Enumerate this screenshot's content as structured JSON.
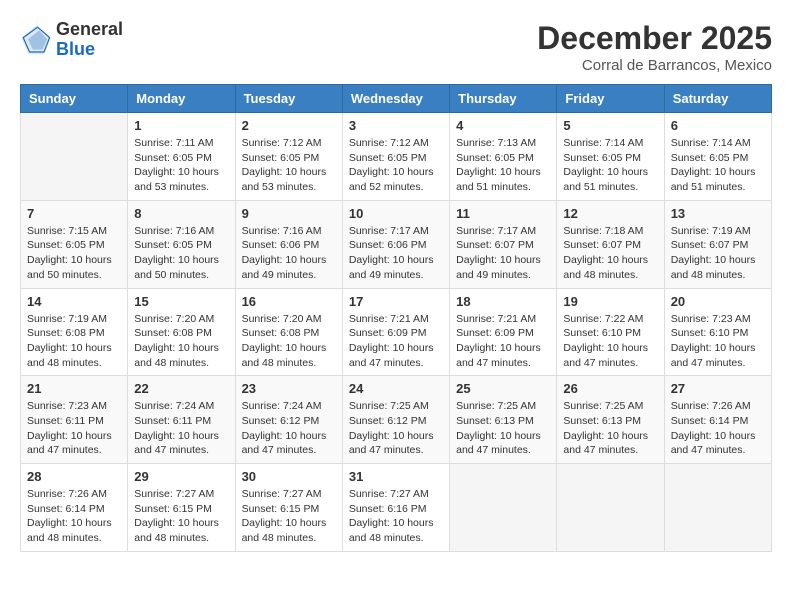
{
  "header": {
    "logo": {
      "general": "General",
      "blue": "Blue"
    },
    "title": "December 2025",
    "location": "Corral de Barrancos, Mexico"
  },
  "days_of_week": [
    "Sunday",
    "Monday",
    "Tuesday",
    "Wednesday",
    "Thursday",
    "Friday",
    "Saturday"
  ],
  "weeks": [
    [
      {
        "day": "",
        "info": ""
      },
      {
        "day": "1",
        "info": "Sunrise: 7:11 AM\nSunset: 6:05 PM\nDaylight: 10 hours\nand 53 minutes."
      },
      {
        "day": "2",
        "info": "Sunrise: 7:12 AM\nSunset: 6:05 PM\nDaylight: 10 hours\nand 53 minutes."
      },
      {
        "day": "3",
        "info": "Sunrise: 7:12 AM\nSunset: 6:05 PM\nDaylight: 10 hours\nand 52 minutes."
      },
      {
        "day": "4",
        "info": "Sunrise: 7:13 AM\nSunset: 6:05 PM\nDaylight: 10 hours\nand 51 minutes."
      },
      {
        "day": "5",
        "info": "Sunrise: 7:14 AM\nSunset: 6:05 PM\nDaylight: 10 hours\nand 51 minutes."
      },
      {
        "day": "6",
        "info": "Sunrise: 7:14 AM\nSunset: 6:05 PM\nDaylight: 10 hours\nand 51 minutes."
      }
    ],
    [
      {
        "day": "7",
        "info": "Sunrise: 7:15 AM\nSunset: 6:05 PM\nDaylight: 10 hours\nand 50 minutes."
      },
      {
        "day": "8",
        "info": "Sunrise: 7:16 AM\nSunset: 6:05 PM\nDaylight: 10 hours\nand 50 minutes."
      },
      {
        "day": "9",
        "info": "Sunrise: 7:16 AM\nSunset: 6:06 PM\nDaylight: 10 hours\nand 49 minutes."
      },
      {
        "day": "10",
        "info": "Sunrise: 7:17 AM\nSunset: 6:06 PM\nDaylight: 10 hours\nand 49 minutes."
      },
      {
        "day": "11",
        "info": "Sunrise: 7:17 AM\nSunset: 6:07 PM\nDaylight: 10 hours\nand 49 minutes."
      },
      {
        "day": "12",
        "info": "Sunrise: 7:18 AM\nSunset: 6:07 PM\nDaylight: 10 hours\nand 48 minutes."
      },
      {
        "day": "13",
        "info": "Sunrise: 7:19 AM\nSunset: 6:07 PM\nDaylight: 10 hours\nand 48 minutes."
      }
    ],
    [
      {
        "day": "14",
        "info": "Sunrise: 7:19 AM\nSunset: 6:08 PM\nDaylight: 10 hours\nand 48 minutes."
      },
      {
        "day": "15",
        "info": "Sunrise: 7:20 AM\nSunset: 6:08 PM\nDaylight: 10 hours\nand 48 minutes."
      },
      {
        "day": "16",
        "info": "Sunrise: 7:20 AM\nSunset: 6:08 PM\nDaylight: 10 hours\nand 48 minutes."
      },
      {
        "day": "17",
        "info": "Sunrise: 7:21 AM\nSunset: 6:09 PM\nDaylight: 10 hours\nand 47 minutes."
      },
      {
        "day": "18",
        "info": "Sunrise: 7:21 AM\nSunset: 6:09 PM\nDaylight: 10 hours\nand 47 minutes."
      },
      {
        "day": "19",
        "info": "Sunrise: 7:22 AM\nSunset: 6:10 PM\nDaylight: 10 hours\nand 47 minutes."
      },
      {
        "day": "20",
        "info": "Sunrise: 7:23 AM\nSunset: 6:10 PM\nDaylight: 10 hours\nand 47 minutes."
      }
    ],
    [
      {
        "day": "21",
        "info": "Sunrise: 7:23 AM\nSunset: 6:11 PM\nDaylight: 10 hours\nand 47 minutes."
      },
      {
        "day": "22",
        "info": "Sunrise: 7:24 AM\nSunset: 6:11 PM\nDaylight: 10 hours\nand 47 minutes."
      },
      {
        "day": "23",
        "info": "Sunrise: 7:24 AM\nSunset: 6:12 PM\nDaylight: 10 hours\nand 47 minutes."
      },
      {
        "day": "24",
        "info": "Sunrise: 7:25 AM\nSunset: 6:12 PM\nDaylight: 10 hours\nand 47 minutes."
      },
      {
        "day": "25",
        "info": "Sunrise: 7:25 AM\nSunset: 6:13 PM\nDaylight: 10 hours\nand 47 minutes."
      },
      {
        "day": "26",
        "info": "Sunrise: 7:25 AM\nSunset: 6:13 PM\nDaylight: 10 hours\nand 47 minutes."
      },
      {
        "day": "27",
        "info": "Sunrise: 7:26 AM\nSunset: 6:14 PM\nDaylight: 10 hours\nand 47 minutes."
      }
    ],
    [
      {
        "day": "28",
        "info": "Sunrise: 7:26 AM\nSunset: 6:14 PM\nDaylight: 10 hours\nand 48 minutes."
      },
      {
        "day": "29",
        "info": "Sunrise: 7:27 AM\nSunset: 6:15 PM\nDaylight: 10 hours\nand 48 minutes."
      },
      {
        "day": "30",
        "info": "Sunrise: 7:27 AM\nSunset: 6:15 PM\nDaylight: 10 hours\nand 48 minutes."
      },
      {
        "day": "31",
        "info": "Sunrise: 7:27 AM\nSunset: 6:16 PM\nDaylight: 10 hours\nand 48 minutes."
      },
      {
        "day": "",
        "info": ""
      },
      {
        "day": "",
        "info": ""
      },
      {
        "day": "",
        "info": ""
      }
    ]
  ]
}
